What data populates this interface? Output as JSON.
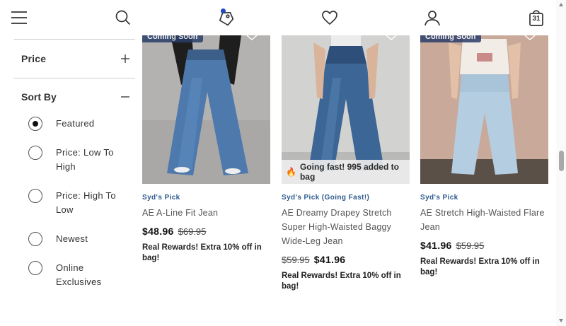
{
  "header": {
    "bag_count": "31"
  },
  "filters": {
    "price_label": "Price",
    "sort_by_label": "Sort By",
    "sort_options": [
      {
        "label": "Featured",
        "selected": true
      },
      {
        "label": "Price: Low To High",
        "selected": false
      },
      {
        "label": "Price: High To Low",
        "selected": false
      },
      {
        "label": "Newest",
        "selected": false
      },
      {
        "label": "Online Exclusives",
        "selected": false
      }
    ]
  },
  "products": [
    {
      "badge": "Coming Soon",
      "pick": "Syd's Pick",
      "name": "AE A-Line Fit Jean",
      "price_first": "$48.96",
      "price_second": "$69.95",
      "reward": "Real Rewards! Extra 10% off in bag!"
    },
    {
      "going_fast": "Going fast! 995 added to bag",
      "pick": "Syd's Pick (Going Fast!)",
      "name": "AE Dreamy Drapey Stretch Super High-Waisted Baggy Wide-Leg Jean",
      "price_first": "$59.95",
      "price_second": "$41.96",
      "reward": "Real Rewards! Extra 10% off in bag!"
    },
    {
      "badge": "Coming Soon",
      "pick": "Syd's Pick",
      "name": "AE Stretch High-Waisted Flare Jean",
      "price_first": "$41.96",
      "price_second": "$59.95",
      "reward": "Real Rewards! Extra 10% off in bag!"
    }
  ],
  "colors": {
    "accent_blue": "#2348c2",
    "pick_blue": "#2d5b8f",
    "badge_navy": "#2a3e6a"
  },
  "icons": [
    "menu-icon",
    "search-icon",
    "tag-icon",
    "heart-icon",
    "account-icon",
    "bag-icon",
    "plus-icon",
    "minus-icon",
    "flame-icon"
  ]
}
